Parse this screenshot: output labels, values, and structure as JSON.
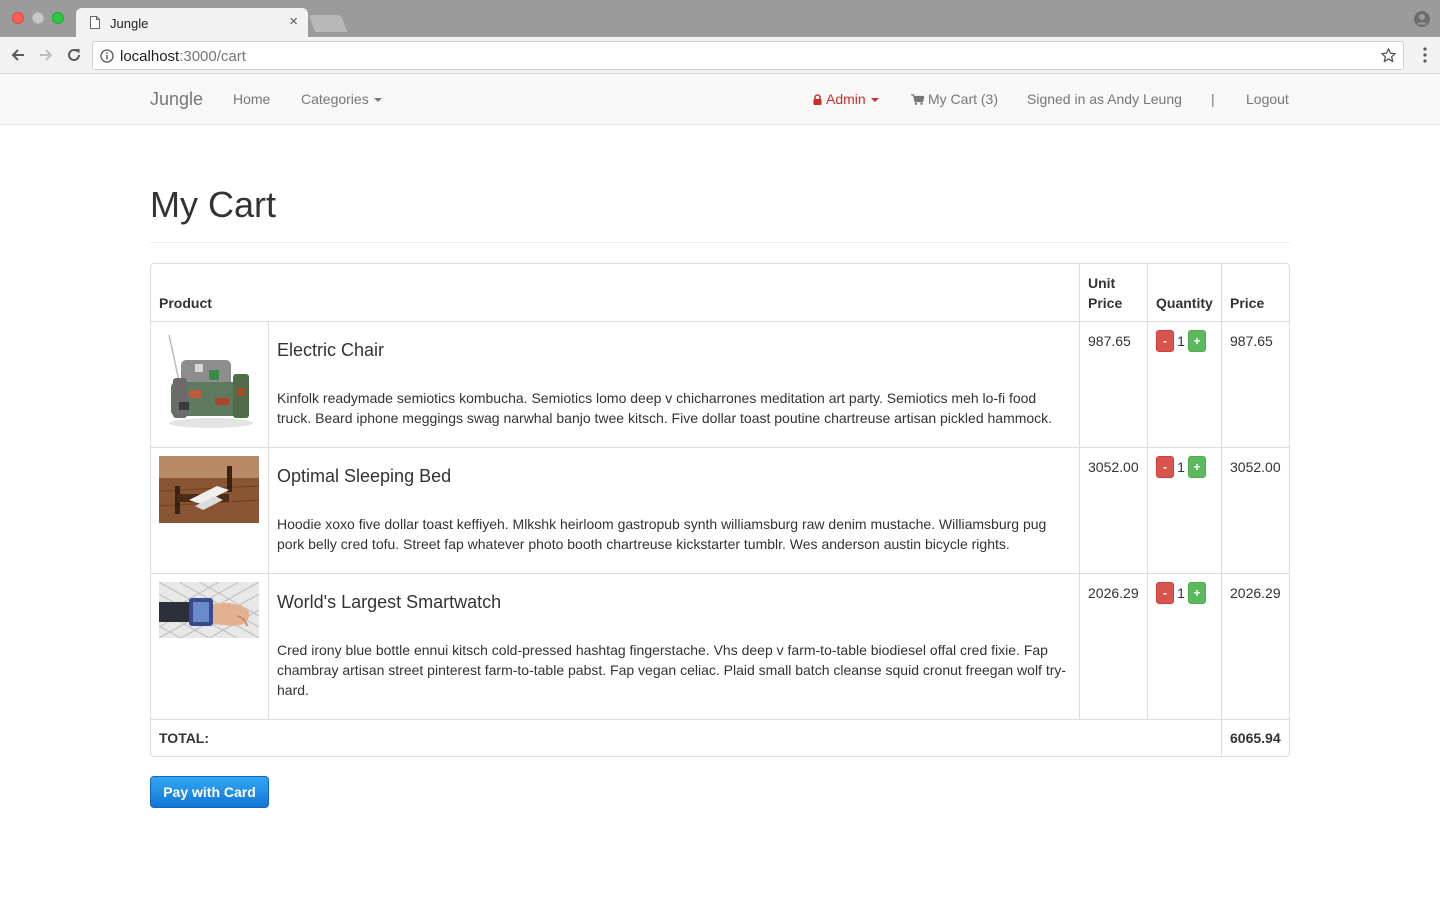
{
  "browser": {
    "tab_title": "Jungle",
    "tab_close": "×",
    "url_host": "localhost",
    "url_rest": ":3000/cart"
  },
  "navbar": {
    "brand": "Jungle",
    "home": "Home",
    "categories": "Categories",
    "admin": "Admin",
    "my_cart": "My Cart (3)",
    "signed_in": "Signed in as Andy Leung",
    "separator": "|",
    "logout": "Logout"
  },
  "page": {
    "title": "My Cart"
  },
  "table": {
    "headers": {
      "product": "Product",
      "unit_price": "Unit Price",
      "quantity": "Quantity",
      "price": "Price"
    },
    "rows": [
      {
        "name": "Electric Chair",
        "description": "Kinfolk readymade semiotics kombucha. Semiotics lomo deep v chicharrones meditation art party. Semiotics meh lo-fi food truck. Beard iphone meggings swag narwhal banjo twee kitsch. Five dollar toast poutine chartreuse artisan pickled hammock.",
        "unit_price": "987.65",
        "quantity": "1",
        "price": "987.65"
      },
      {
        "name": "Optimal Sleeping Bed",
        "description": "Hoodie xoxo five dollar toast keffiyeh. Mlkshk heirloom gastropub synth williamsburg raw denim mustache. Williamsburg pug pork belly cred tofu. Street fap whatever photo booth chartreuse kickstarter tumblr. Wes anderson austin bicycle rights.",
        "unit_price": "3052.00",
        "quantity": "1",
        "price": "3052.00"
      },
      {
        "name": "World's Largest Smartwatch",
        "description": "Cred irony blue bottle ennui kitsch cold-pressed hashtag fingerstache. Vhs deep v farm-to-table biodiesel offal cred fixie. Fap chambray artisan street pinterest farm-to-table pabst. Fap vegan celiac. Plaid small batch cleanse squid cronut freegan wolf try-hard.",
        "unit_price": "2026.29",
        "quantity": "1",
        "price": "2026.29"
      }
    ],
    "minus_label": "-",
    "plus_label": "+",
    "total_label": "TOTAL:",
    "total_value": "6065.94"
  },
  "pay_button": "Pay with Card",
  "colors": {
    "admin": "#c9302c",
    "minus_button": "#d9534f",
    "plus_button": "#5cb85c",
    "pay_button": "#1a87e2"
  }
}
